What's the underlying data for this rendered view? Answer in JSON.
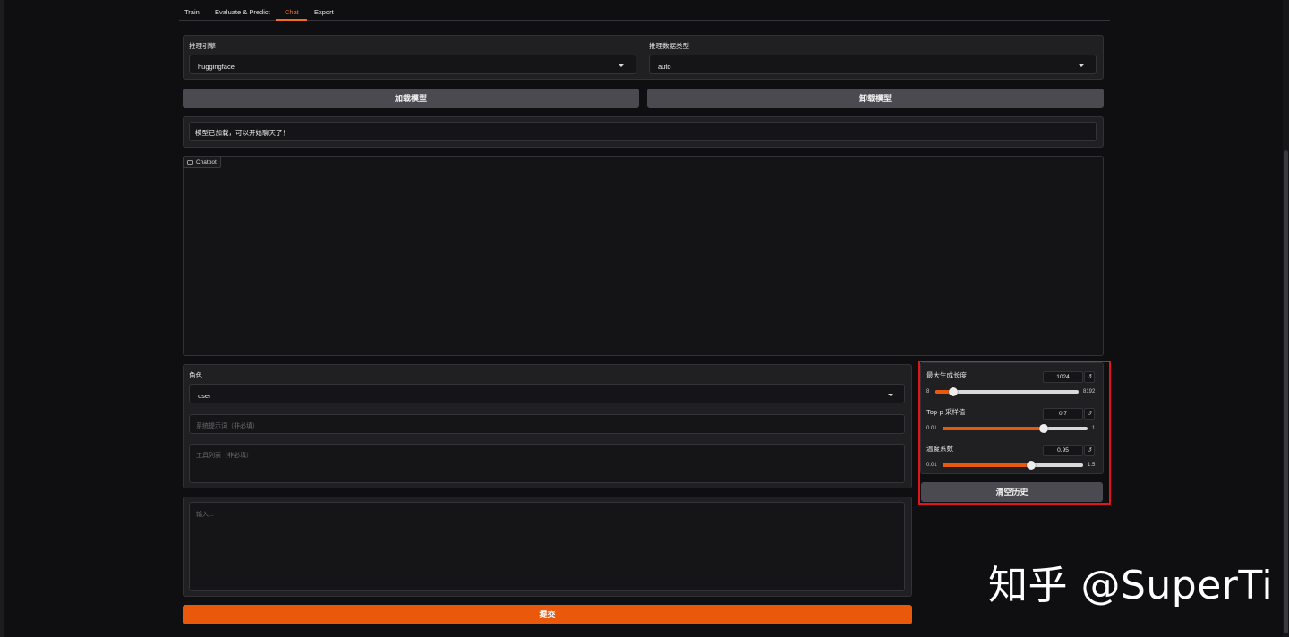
{
  "tabs": [
    "Train",
    "Evaluate & Predict",
    "Chat",
    "Export"
  ],
  "active_tab": "Chat",
  "infer": {
    "backend_label": "推理引擎",
    "backend_value": "huggingface",
    "dtype_label": "推理数据类型",
    "dtype_value": "auto"
  },
  "buttons": {
    "load": "加载模型",
    "unload": "卸载模型",
    "clear": "清空历史",
    "submit": "提交"
  },
  "status_message": "模型已加载，可以开始聊天了！",
  "chatbot": {
    "label": "Chatbot"
  },
  "role": {
    "label": "角色",
    "value": "user"
  },
  "system_prompt": {
    "placeholder": "系统提示词（非必填）"
  },
  "tools": {
    "placeholder": "工具列表（非必填）"
  },
  "query": {
    "placeholder": "输入..."
  },
  "params": {
    "max_new_tokens": {
      "label": "最大生成长度",
      "value": "1024",
      "min": "8",
      "max": "8192",
      "fraction": 0.124
    },
    "top_p": {
      "label": "Top-p 采样值",
      "value": "0.7",
      "min": "0.01",
      "max": "1",
      "fraction": 0.697
    },
    "temperature": {
      "label": "温度系数",
      "value": "0.95",
      "min": "0.01",
      "max": "1.5",
      "fraction": 0.631
    }
  },
  "icons": {
    "reset": "reset-icon",
    "chat": "chat-bubble-icon",
    "dropdown": "chevron-down-icon"
  },
  "colors": {
    "accent": "#ea580c",
    "highlight": "#e0161b",
    "background": "#0f0f11"
  },
  "watermark": "知乎 @SuperTi"
}
